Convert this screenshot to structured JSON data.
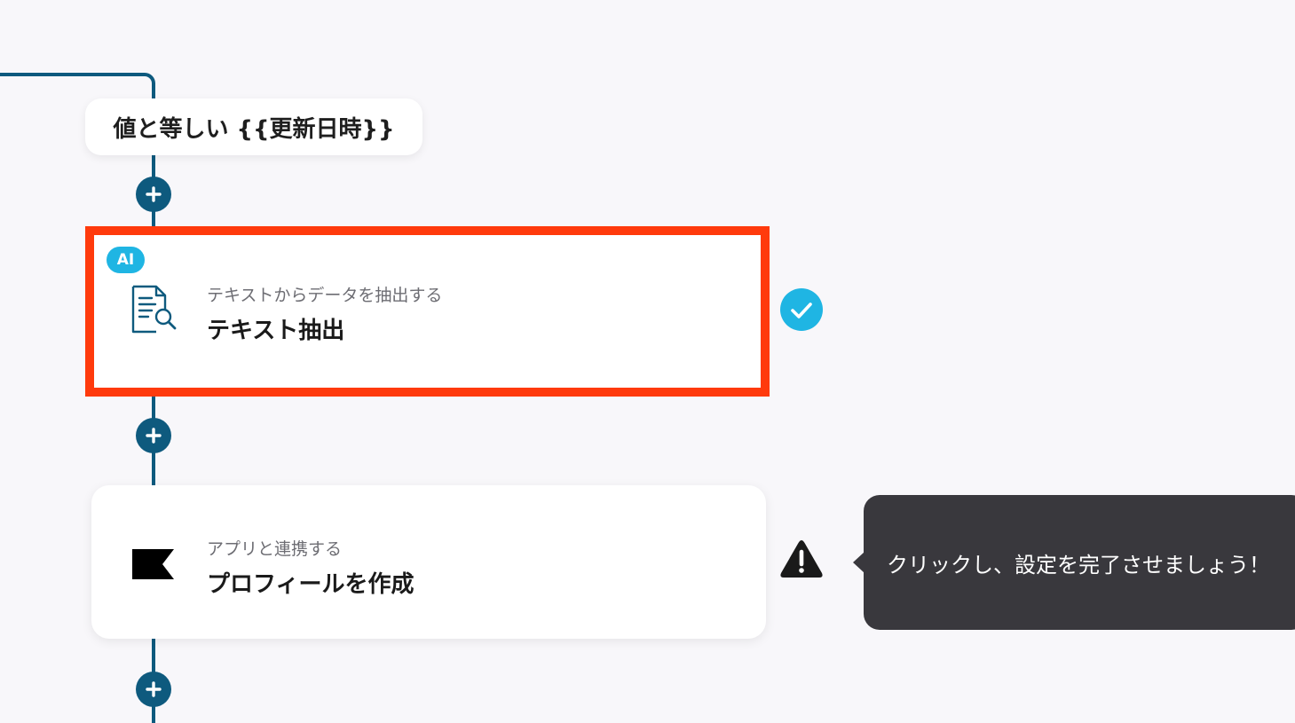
{
  "condition": {
    "label": "値と等しい {{更新日時}}"
  },
  "steps": [
    {
      "badge": "AI",
      "icon": "document-search-icon",
      "subtitle": "テキストからデータを抽出する",
      "title": "テキスト抽出",
      "status": "complete-check-icon",
      "highlighted": true
    },
    {
      "icon": "flag-icon",
      "subtitle": "アプリと連携する",
      "title": "プロフィールを作成",
      "status": "warning-icon"
    }
  ],
  "tooltip": {
    "text": "クリックし、設定を完了させましょう！"
  },
  "colors": {
    "connector": "#0e5a7e",
    "highlight": "#ff3a0c",
    "ai_badge": "#1fb5e3",
    "check": "#1fb5e3",
    "tooltip_bg": "#39383d",
    "background": "#f8f7fa"
  }
}
